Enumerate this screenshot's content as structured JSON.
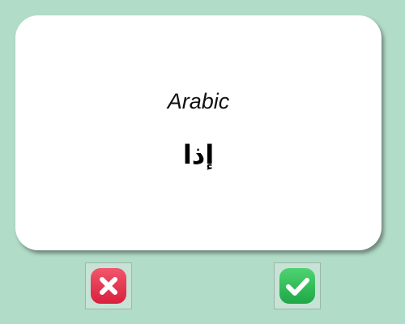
{
  "card": {
    "language": "Arabic",
    "word": "إذا"
  },
  "buttons": {
    "wrong": {
      "icon": "close-icon",
      "color": "#e8334f"
    },
    "right": {
      "icon": "check-icon",
      "color": "#2fbf56"
    }
  },
  "colors": {
    "background": "#b1dcc7",
    "card": "#ffffff"
  }
}
